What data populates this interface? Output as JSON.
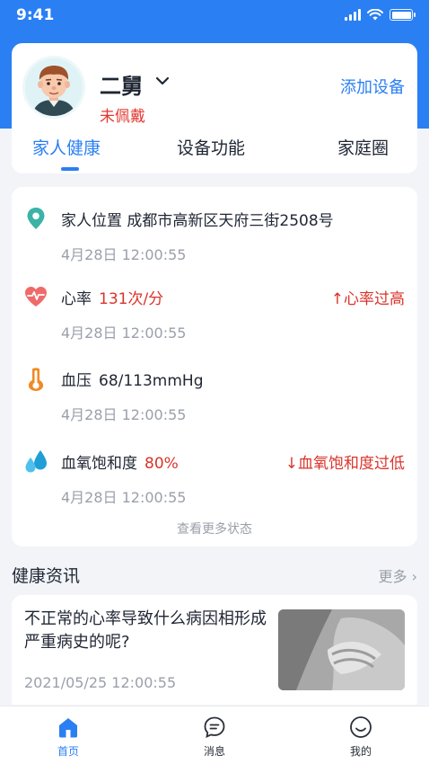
{
  "status_bar": {
    "time": "9:41"
  },
  "profile": {
    "name": "二舅",
    "wear_status": "未佩戴",
    "add_device": "添加设备"
  },
  "tabs": [
    {
      "label": "家人健康",
      "active": true
    },
    {
      "label": "设备功能",
      "active": false
    },
    {
      "label": "家庭圈",
      "active": false
    }
  ],
  "health": {
    "location": {
      "label": "家人位置",
      "value": "成都市高新区天府三街2508号",
      "time": "4月28日  12:00:55",
      "icon": "location-pin-icon"
    },
    "heart_rate": {
      "label": "心率",
      "value": "131次/分",
      "warning": "↑心率过高",
      "time": "4月28日  12:00:55",
      "icon": "heart-rate-icon"
    },
    "blood_pressure": {
      "label": "血压",
      "value": "68/113mmHg",
      "time": "4月28日  12:00:55",
      "icon": "thermometer-icon"
    },
    "blood_oxygen": {
      "label": "血氧饱和度",
      "value": "80%",
      "warning": "↓血氧饱和度过低",
      "time": "4月28日  12:00:55",
      "icon": "water-drops-icon"
    },
    "more_status": "查看更多状态"
  },
  "news": {
    "title": "健康资讯",
    "more": "更多 ›",
    "items": [
      {
        "headline": "不正常的心率导致什么病因相形成严重病史的呢?",
        "date": "2021/05/25  12:00:55"
      }
    ]
  },
  "bottom_nav": [
    {
      "label": "首页",
      "icon": "home-icon",
      "active": true
    },
    {
      "label": "消息",
      "icon": "message-icon",
      "active": false
    },
    {
      "label": "我的",
      "icon": "profile-smile-icon",
      "active": false
    }
  ],
  "colors": {
    "primary": "#2a7ff3",
    "warning_red": "#d9342b",
    "location_teal": "#3bb3a6",
    "thermometer_orange": "#f08a24",
    "drops_blue": "#1f9fd6"
  }
}
